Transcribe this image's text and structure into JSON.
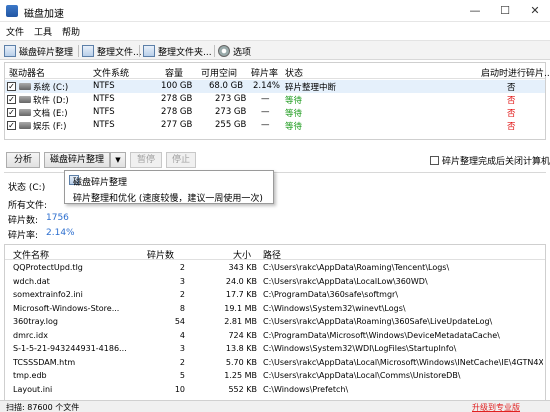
{
  "window": {
    "title": "磁盘加速",
    "min": "—",
    "max": "☐",
    "close": "✕"
  },
  "menu": [
    "文件",
    "工具",
    "帮助"
  ],
  "toolbar": {
    "defrag": "磁盘碎片整理",
    "defrag_file": "整理文件...",
    "defrag_folder": "整理文件夹...",
    "options": "选项"
  },
  "drives": {
    "headers": {
      "name": "驱动器名",
      "fs": "文件系统",
      "capacity": "容量",
      "free": "可用空间",
      "frag": "碎片率",
      "status": "状态",
      "startup": "启动时进行碎片..."
    },
    "rows": [
      {
        "name": "系统 (C:)",
        "fs": "NTFS",
        "capacity": "100 GB",
        "free": "68.0 GB",
        "frag": "2.14%",
        "status": "碎片整理中断",
        "startup": "否",
        "checked": "✓"
      },
      {
        "name": "软件 (D:)",
        "fs": "NTFS",
        "capacity": "278 GB",
        "free": "273 GB",
        "frag": "—",
        "status": "等待",
        "startup": "否",
        "checked": "✓"
      },
      {
        "name": "文档 (E:)",
        "fs": "NTFS",
        "capacity": "278 GB",
        "free": "273 GB",
        "frag": "—",
        "status": "等待",
        "startup": "否",
        "checked": "✓"
      },
      {
        "name": "娱乐 (F:)",
        "fs": "NTFS",
        "capacity": "277 GB",
        "free": "255 GB",
        "frag": "—",
        "status": "等待",
        "startup": "否",
        "checked": "✓"
      }
    ]
  },
  "actions": {
    "analyze": "分析",
    "defrag": "磁盘碎片整理",
    "arrow": "▼",
    "pause": "暂停",
    "stop": "停止",
    "shutdown_label": "碎片整理完成后关闭计算机"
  },
  "popup": {
    "item1": "磁盘碎片整理",
    "item2": "碎片整理和优化 (速度较慢，建议一周使用一次)"
  },
  "info": {
    "status_label": "状态 (C:)",
    "all_files_label": "所有文件:",
    "frag_count_label": "碎片数:",
    "frag_count_value": "1756",
    "frag_rate_label": "碎片率:",
    "frag_rate_value": "2.14%"
  },
  "files": {
    "headers": {
      "name": "文件名称",
      "frags": "碎片数",
      "size": "大小",
      "path": "路径"
    },
    "rows": [
      {
        "name": "QQProtectUpd.tlg",
        "frags": "2",
        "size": "343 KB",
        "path": "C:\\Users\\rakc\\AppData\\Roaming\\Tencent\\Logs\\"
      },
      {
        "name": "wdch.dat",
        "frags": "3",
        "size": "24.0 KB",
        "path": "C:\\Users\\rakc\\AppData\\LocalLow\\360WD\\"
      },
      {
        "name": "somextrainfo2.ini",
        "frags": "2",
        "size": "17.7 KB",
        "path": "C:\\ProgramData\\360safe\\softmgr\\"
      },
      {
        "name": "Microsoft-Windows-Store...",
        "frags": "8",
        "size": "19.1 MB",
        "path": "C:\\Windows\\System32\\winevt\\Logs\\"
      },
      {
        "name": "360tray.log",
        "frags": "54",
        "size": "2.81 MB",
        "path": "C:\\Users\\rakc\\AppData\\Roaming\\360Safe\\LiveUpdateLog\\"
      },
      {
        "name": "dmrc.idx",
        "frags": "4",
        "size": "724 KB",
        "path": "C:\\ProgramData\\Microsoft\\Windows\\DeviceMetadataCache\\"
      },
      {
        "name": "S-1-5-21-943244931-4186...",
        "frags": "3",
        "size": "13.8 KB",
        "path": "C:\\Windows\\System32\\WDI\\LogFiles\\StartupInfo\\"
      },
      {
        "name": "TCSSSDAM.htm",
        "frags": "2",
        "size": "5.70 KB",
        "path": "C:\\Users\\rakc\\AppData\\Local\\Microsoft\\Windows\\INetCache\\IE\\4GTN4XFV\\"
      },
      {
        "name": "tmp.edb",
        "frags": "5",
        "size": "1.25 MB",
        "path": "C:\\Users\\rakc\\AppData\\Local\\Comms\\UnistoreDB\\"
      },
      {
        "name": "Layout.ini",
        "frags": "10",
        "size": "552 KB",
        "path": "C:\\Windows\\Prefetch\\"
      }
    ]
  },
  "statusbar": {
    "left": "扫描: 87600 个文件",
    "right": "升级到专业版"
  },
  "colors": {
    "accent": "#2d6fcf",
    "status_green": "#1a9a1a",
    "status_red": "#e01010"
  }
}
